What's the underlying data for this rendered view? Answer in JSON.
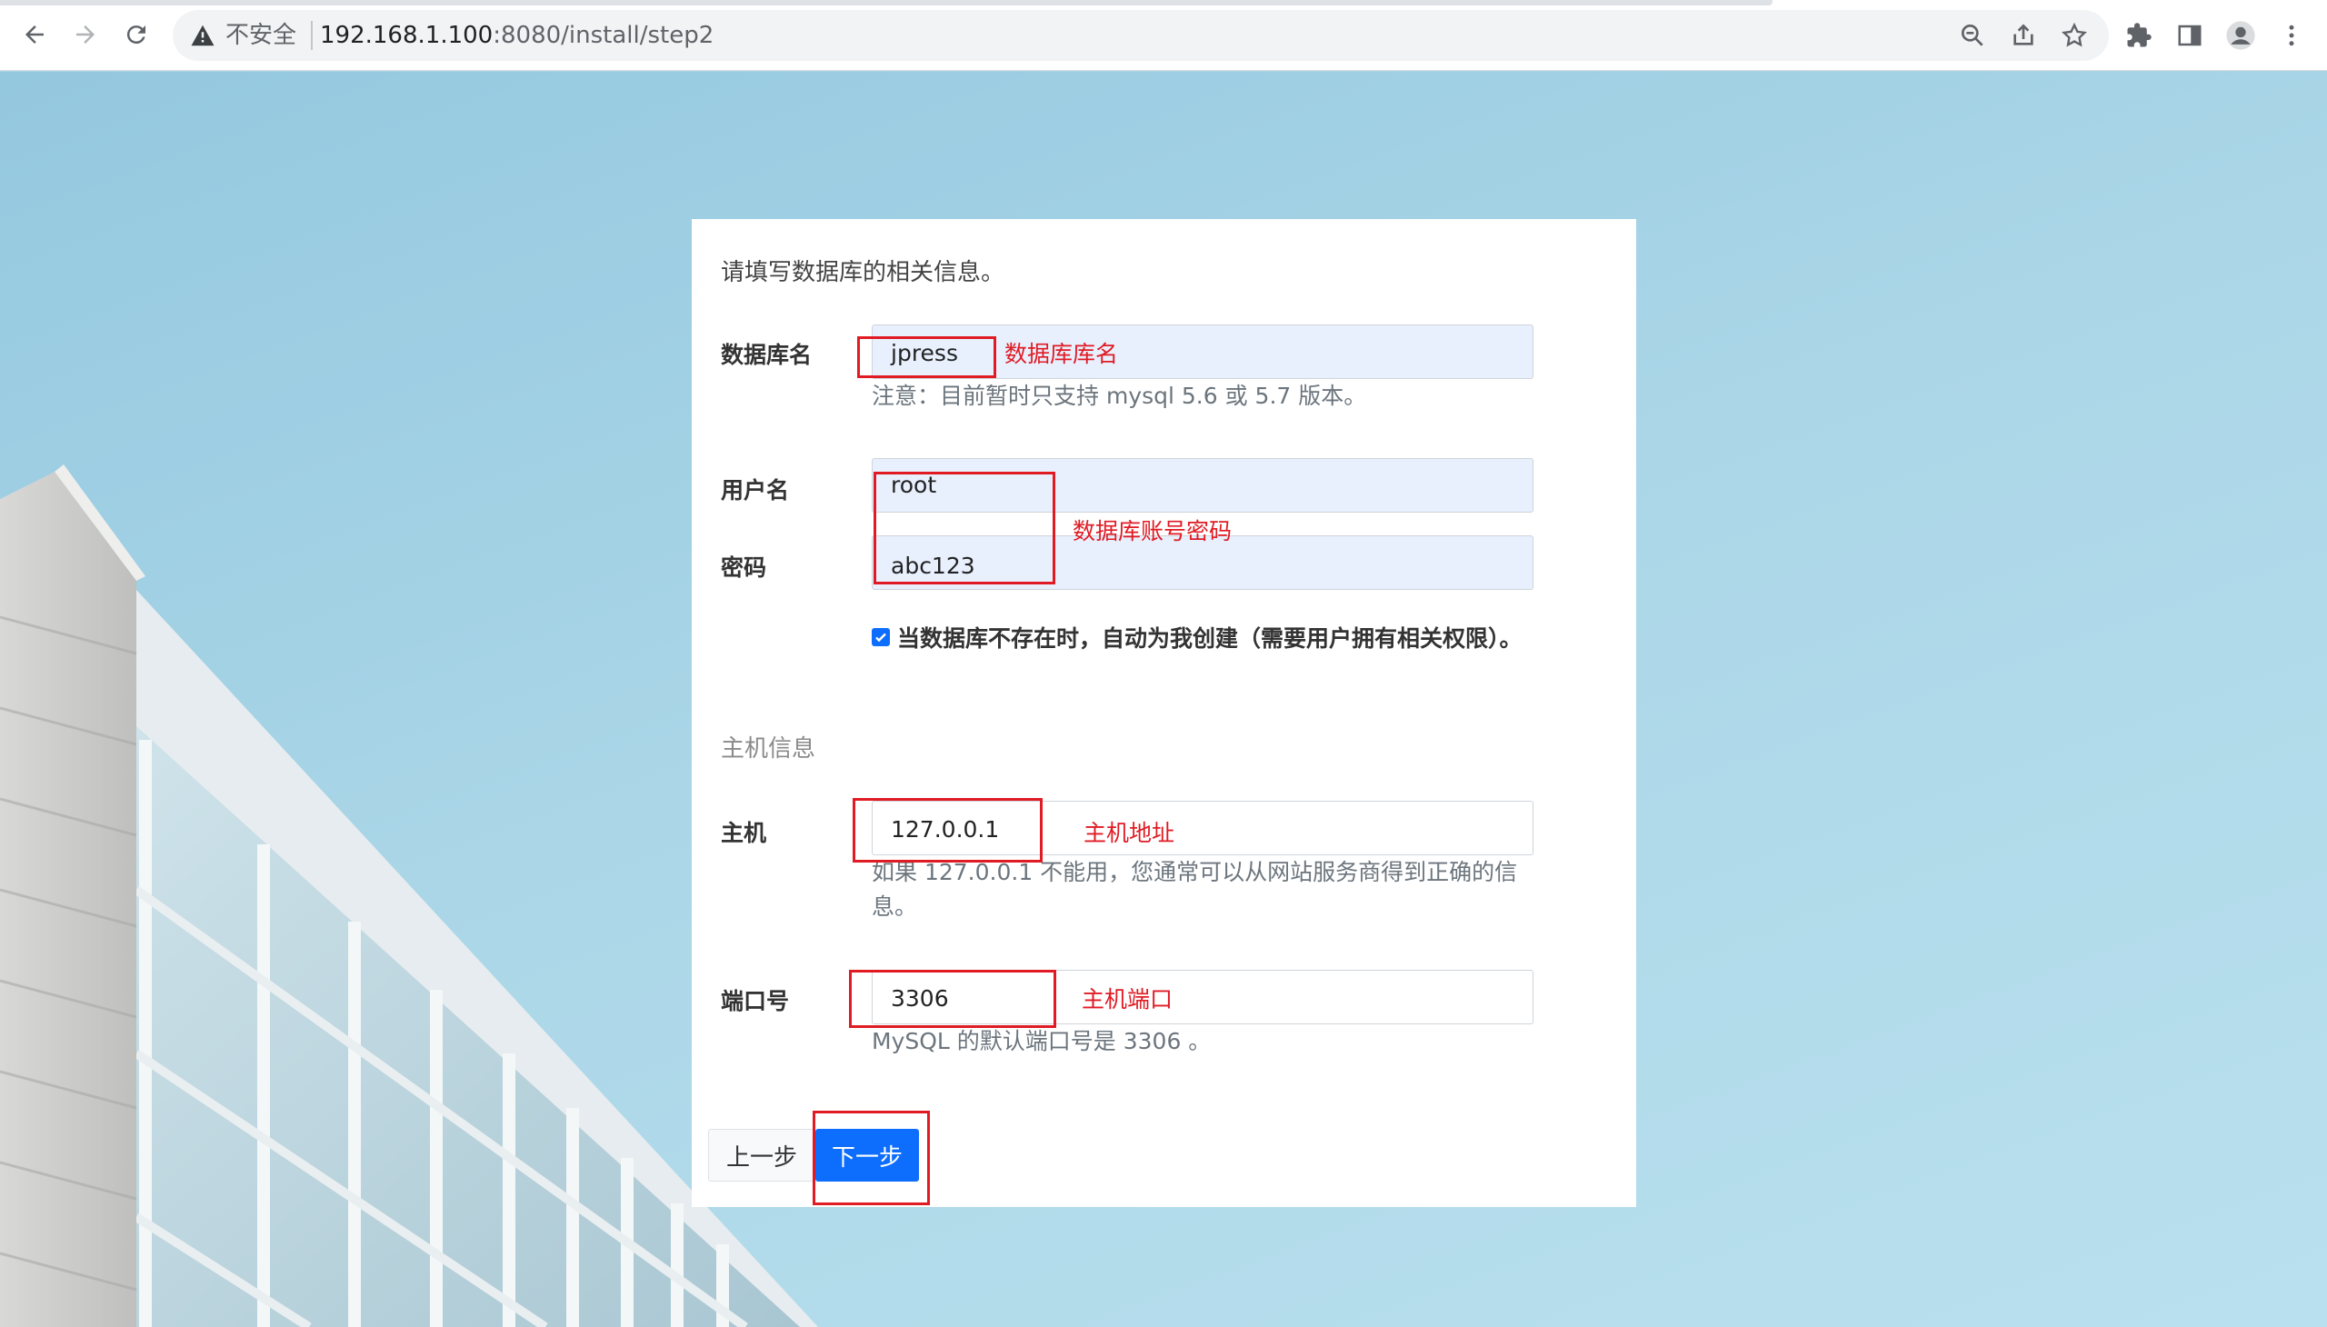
{
  "browser": {
    "security_label": "不安全",
    "url_host": "192.168.1.100",
    "url_rest": ":8080/install/step2"
  },
  "panel": {
    "intro": "请填写数据库的相关信息。",
    "db_name": {
      "label": "数据库名",
      "value": "jpress",
      "help": "注意：目前暂时只支持 mysql 5.6 或 5.7 版本。"
    },
    "username": {
      "label": "用户名",
      "value": "root"
    },
    "password": {
      "label": "密码",
      "value": "abc123"
    },
    "auto_create": {
      "checked": true,
      "label": "当数据库不存在时，自动为我创建（需要用户拥有相关权限）。"
    },
    "host_section": "主机信息",
    "host": {
      "label": "主机",
      "value": "127.0.0.1",
      "help": "如果 127.0.0.1 不能用，您通常可以从网站服务商得到正确的信息。"
    },
    "port": {
      "label": "端口号",
      "value": "3306",
      "help": "MySQL 的默认端口号是 3306 。"
    },
    "prev_button": "上一步",
    "next_button": "下一步"
  },
  "annotations": {
    "db_name_note": "数据库库名",
    "account_note": "数据库账号密码",
    "host_note": "主机地址",
    "port_note": "主机端口"
  },
  "colors": {
    "annotation_red": "#e01b24",
    "primary_blue": "#0d6efd",
    "autofill_bg": "#e8f0fe"
  },
  "icons": [
    "back-arrow-icon",
    "forward-arrow-icon",
    "reload-icon",
    "warning-icon",
    "zoom-icon",
    "share-icon",
    "star-icon",
    "extensions-icon",
    "side-panel-icon",
    "profile-icon",
    "menu-icon"
  ]
}
